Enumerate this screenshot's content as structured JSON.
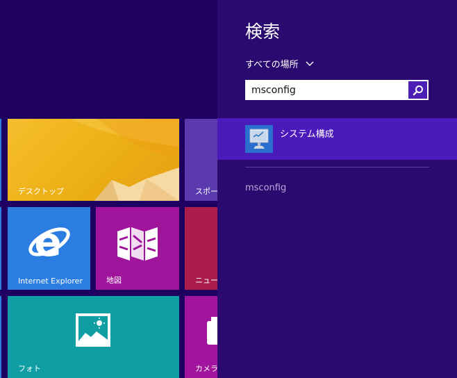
{
  "start": {
    "tiles": {
      "desktop": "デスクトップ",
      "sports": "スポー",
      "ie": "Internet Explorer",
      "maps": "地図",
      "news": "ニュー",
      "photos": "フォト",
      "camera": "カメラ"
    }
  },
  "search": {
    "title": "検索",
    "scope": "すべての場所",
    "query": "msconfig",
    "results": [
      {
        "label": "システム構成",
        "icon": "system-configuration-icon"
      }
    ],
    "suggestions": [
      "msconfig"
    ]
  },
  "colors": {
    "background": "#1e0060",
    "pane": "#2a0a6e",
    "selected_result": "#4a1aba",
    "search_button": "#4b1fb4"
  }
}
